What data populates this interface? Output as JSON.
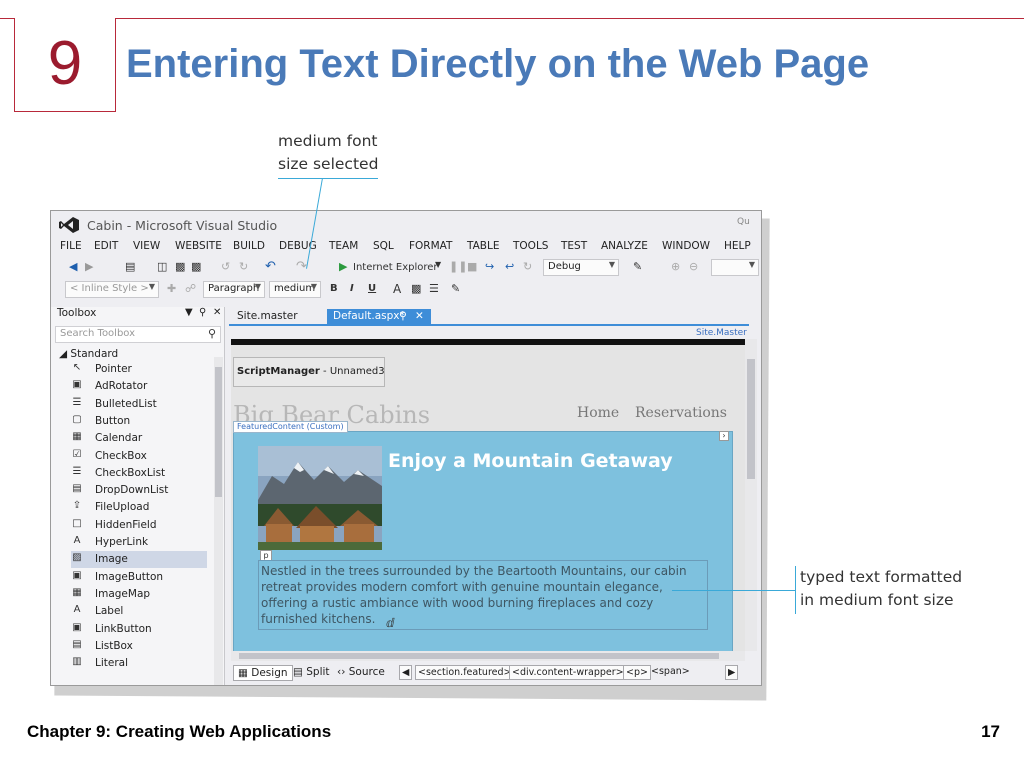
{
  "slide": {
    "number": "9",
    "title": "Entering Text Directly on the Web Page",
    "footer_left": "Chapter 9: Creating Web Applications",
    "footer_right": "17"
  },
  "callouts": {
    "top": [
      "medium font",
      "size selected"
    ],
    "right": [
      "typed text formatted",
      "in medium font size"
    ]
  },
  "window": {
    "title": "Cabin - Microsoft Visual Studio",
    "quick_launch": "Qu",
    "menu": [
      "FILE",
      "EDIT",
      "VIEW",
      "WEBSITE",
      "BUILD",
      "DEBUG",
      "TEAM",
      "SQL",
      "FORMAT",
      "TABLE",
      "TOOLS",
      "TEST",
      "ANALYZE",
      "WINDOW",
      "HELP"
    ]
  },
  "toolbar": {
    "browser": "Internet Explorer",
    "config": "Debug",
    "style": "< Inline Style >",
    "block": "Paragraph",
    "font_size": "medium",
    "bold": "B",
    "italic": "I",
    "underline": "U",
    "font_color": "A"
  },
  "toolbox": {
    "title": "Toolbox",
    "search_placeholder": "Search Toolbox",
    "group": "Standard",
    "items": [
      {
        "label": "Pointer",
        "icon": "pointer-icon"
      },
      {
        "label": "AdRotator",
        "icon": "adrotator-icon"
      },
      {
        "label": "BulletedList",
        "icon": "bulleted-list-icon"
      },
      {
        "label": "Button",
        "icon": "button-icon"
      },
      {
        "label": "Calendar",
        "icon": "calendar-icon"
      },
      {
        "label": "CheckBox",
        "icon": "checkbox-icon"
      },
      {
        "label": "CheckBoxList",
        "icon": "checkbox-list-icon"
      },
      {
        "label": "DropDownList",
        "icon": "dropdown-list-icon"
      },
      {
        "label": "FileUpload",
        "icon": "file-upload-icon"
      },
      {
        "label": "HiddenField",
        "icon": "hidden-field-icon"
      },
      {
        "label": "HyperLink",
        "icon": "hyperlink-icon"
      },
      {
        "label": "Image",
        "icon": "image-icon",
        "selected": true
      },
      {
        "label": "ImageButton",
        "icon": "image-button-icon"
      },
      {
        "label": "ImageMap",
        "icon": "image-map-icon"
      },
      {
        "label": "Label",
        "icon": "label-icon"
      },
      {
        "label": "LinkButton",
        "icon": "link-button-icon"
      },
      {
        "label": "ListBox",
        "icon": "listbox-icon"
      },
      {
        "label": "Literal",
        "icon": "literal-icon"
      }
    ]
  },
  "editor": {
    "tabs": [
      {
        "label": "Site.master",
        "active": false
      },
      {
        "label": "Default.aspx*",
        "active": true
      }
    ],
    "master_link": "Site.Master",
    "script_manager": {
      "name": "ScriptManager",
      "id": " - Unnamed3"
    },
    "brand": "Big Bear Cabins",
    "nav": [
      "Home",
      "Reservations"
    ],
    "section_tag": "FeaturedContent (Custom)",
    "p_tag": "p",
    "headline": "Enjoy a Mountain Getaway",
    "paragraph_lines": [
      "Nestled in the trees surrounded by the Beartooth Mountains, our cabin",
      "retreat provides modern comfort with genuine mountain elegance,",
      "offering a rustic ambiance with wood burning fireplaces and cozy",
      "furnished kitchens."
    ]
  },
  "bottom": {
    "views": [
      {
        "label": "Design",
        "selected": true
      },
      {
        "label": "Split",
        "selected": false
      },
      {
        "label": "Source",
        "selected": false
      }
    ],
    "crumbs": [
      "<section.featured>",
      "<div.content-wrapper>",
      "<p>",
      "<span>"
    ]
  },
  "colors": {
    "accent_red": "#9b1b2e",
    "title_blue": "#4a7ab8",
    "callout_line": "#3aa9d8",
    "vs_tab": "#3e8dd8",
    "featured_bg": "#7ec1de"
  }
}
